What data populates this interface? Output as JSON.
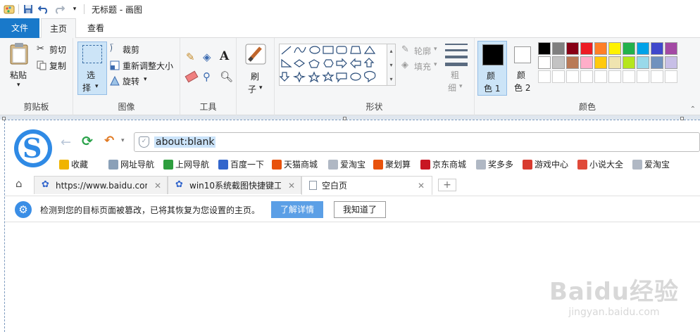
{
  "window": {
    "title": "无标题 - 画图"
  },
  "ribbon_tabs": {
    "file": "文件",
    "home": "主页",
    "view": "查看"
  },
  "clipboard": {
    "paste": "粘贴",
    "cut": "剪切",
    "copy": "复制",
    "group": "剪贴板"
  },
  "image": {
    "select": "选",
    "select2": "择",
    "crop": "裁剪",
    "resize": "重新调整大小",
    "rotate": "旋转",
    "group": "图像"
  },
  "tools": {
    "group": "工具"
  },
  "brushes": {
    "label1": "刷",
    "label2": "子"
  },
  "shapes": {
    "outline": "轮廓",
    "fill": "填充",
    "group": "形状"
  },
  "size": {
    "label1": "粗",
    "label2": "细"
  },
  "colors": {
    "color1": "颜",
    "color1b": "色 1",
    "color2": "颜",
    "color2b": "色 2",
    "group": "颜色",
    "row1": [
      "#000000",
      "#7f7f7f",
      "#880015",
      "#ed1c24",
      "#ff7f27",
      "#fff200",
      "#22b14c",
      "#00a2e8",
      "#3f48cc",
      "#a349a4"
    ],
    "row2": [
      "#ffffff",
      "#c3c3c3",
      "#b97a57",
      "#ffaec9",
      "#ffc90e",
      "#efe4b0",
      "#b5e61d",
      "#99d9ea",
      "#7092be",
      "#c8bfe7"
    ],
    "active1": "#000000",
    "active2": "#ffffff"
  },
  "browser": {
    "address": "about:blank",
    "favorites": [
      {
        "label": "收藏",
        "color": "#f0b400"
      },
      {
        "label": "网址导航",
        "color": "#8aa0b8"
      },
      {
        "label": "上网导航",
        "color": "#2e9e3e"
      },
      {
        "label": "百度一下",
        "color": "#3366cc"
      },
      {
        "label": "天猫商城",
        "color": "#e8520c"
      },
      {
        "label": "爱淘宝",
        "color": "#b0b8c4"
      },
      {
        "label": "聚划算",
        "color": "#e8520c"
      },
      {
        "label": "京东商城",
        "color": "#c81623"
      },
      {
        "label": "奖多多",
        "color": "#b0b8c4"
      },
      {
        "label": "游戏中心",
        "color": "#d83b2f"
      },
      {
        "label": "小说大全",
        "color": "#e04a3a"
      },
      {
        "label": "爱淘宝",
        "color": "#b0b8c4"
      }
    ],
    "tabs": [
      {
        "label": "https://www.baidu.com"
      },
      {
        "label": "win10系统截图快捷键工"
      },
      {
        "label": "空白页"
      }
    ],
    "notice": {
      "text": "检测到您的目标页面被篡改，已将其恢复为您设置的主页。",
      "details": "了解详情",
      "ok": "我知道了"
    }
  },
  "watermark": {
    "brand": "Baidu经验",
    "url": "jingyan.baidu.com"
  }
}
